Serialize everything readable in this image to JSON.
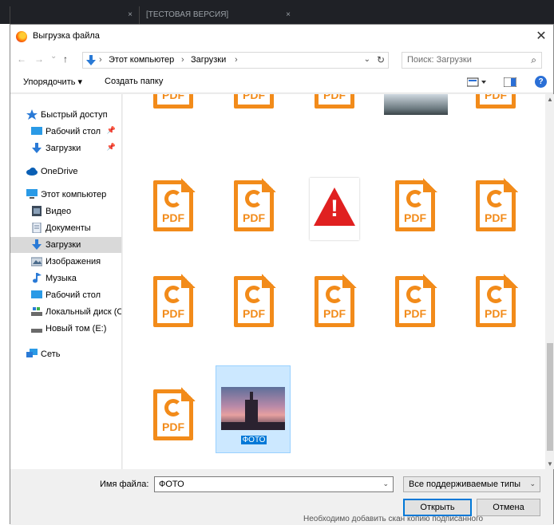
{
  "dialog": {
    "title": "Выгрузка файла",
    "close_glyph": "✕"
  },
  "nav": {
    "back_glyph": "←",
    "forward_glyph": "→",
    "recent_glyph": "⌄",
    "up_glyph": "↑",
    "breadcrumb": [
      "Этот компьютер",
      "Загрузки"
    ],
    "separator": "›",
    "dropdown_glyph": "⌄",
    "refresh_glyph": "↻",
    "search_placeholder": "Поиск: Загрузки",
    "search_glyph": "⌕"
  },
  "toolbar": {
    "organize_label": "Упорядочить ▾",
    "new_folder_label": "Создать папку",
    "help_glyph": "?"
  },
  "sidebar": {
    "items": [
      {
        "label": "Быстрый доступ",
        "icon": "star-icon"
      },
      {
        "label": "Рабочий стол",
        "icon": "desktop-icon",
        "pinned": true
      },
      {
        "label": "Загрузки",
        "icon": "download-icon",
        "pinned": true
      },
      {
        "label": "OneDrive",
        "icon": "cloud-icon"
      },
      {
        "label": "Этот компьютер",
        "icon": "computer-icon"
      },
      {
        "label": "Видео",
        "icon": "video-icon"
      },
      {
        "label": "Документы",
        "icon": "documents-icon"
      },
      {
        "label": "Загрузки",
        "icon": "download-icon",
        "selected": true
      },
      {
        "label": "Изображения",
        "icon": "pictures-icon"
      },
      {
        "label": "Музыка",
        "icon": "music-icon"
      },
      {
        "label": "Рабочий стол",
        "icon": "desktop-icon"
      },
      {
        "label": "Локальный диск (С",
        "icon": "drive-icon"
      },
      {
        "label": "Новый том (E:)",
        "icon": "drive-icon"
      },
      {
        "label": "Сеть",
        "icon": "network-icon"
      }
    ],
    "pin_glyph": "📌"
  },
  "files": {
    "pdf_label": "PDF",
    "warning_glyph": "!",
    "selected_file_label": "ФОТО"
  },
  "bottom": {
    "filename_label": "Имя файла:",
    "filename_value": "ФОТО",
    "filetype_value": "Все поддерживаемые типы",
    "open_label": "Открыть",
    "cancel_label": "Отмена",
    "dropdown_glyph": "⌄"
  },
  "background": {
    "tab1_close": "×",
    "tab2_text": "[ТЕСТОВАЯ ВЕРСИЯ]",
    "tab2_close": "×",
    "bottom_text": "Необходимо добавить скан копию подписанного"
  },
  "colors": {
    "accent": "#0078d7",
    "pdf_orange": "#f28b1a",
    "warning_red": "#e02020",
    "selection": "#cce8ff"
  }
}
